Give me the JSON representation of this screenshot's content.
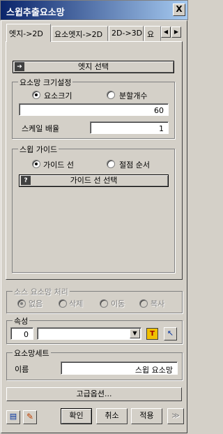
{
  "window": {
    "title": "스윕추출요소망",
    "close_label": "X"
  },
  "tabs": [
    {
      "label": "엣지->2D"
    },
    {
      "label": "요소엣지->2D"
    },
    {
      "label": "2D->3D"
    },
    {
      "label": "요"
    }
  ],
  "tab_scroll": {
    "left": "◀",
    "right": "▶"
  },
  "edge_select": {
    "label": "엣지 선택"
  },
  "element_size": {
    "title": "요소망 크기설정",
    "radio_size": "요소크기",
    "radio_count": "분할개수",
    "size_value": "60",
    "scale_label": "스케일 배율",
    "scale_value": "1"
  },
  "sweep_guide": {
    "title": "스윕 가이드",
    "radio_line": "가이드 선",
    "radio_node": "절점 순서",
    "select_button": "가이드 선 선택",
    "select_icon": "?"
  },
  "source_mesh": {
    "title": "소스 요소망 처리",
    "options": [
      "없음",
      "삭제",
      "이동",
      "복사"
    ]
  },
  "property": {
    "title": "속성",
    "id": "0",
    "dropdown_value": ""
  },
  "mesh_set": {
    "title": "요소망세트",
    "name_label": "이름",
    "name_value": "스윕 요소망"
  },
  "advanced_button": "고급옵션...",
  "footer": {
    "ok": "확인",
    "cancel": "취소",
    "apply": "적용",
    "more": "≫"
  }
}
